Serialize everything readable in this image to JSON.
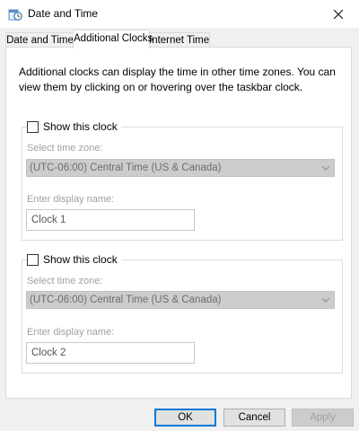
{
  "window": {
    "title": "Date and Time"
  },
  "tabs": [
    {
      "label": "Date and Time",
      "active": false
    },
    {
      "label": "Additional Clocks",
      "active": true
    },
    {
      "label": "Internet Time",
      "active": false
    }
  ],
  "panel": {
    "description": "Additional clocks can display the time in other time zones. You can view them by clicking on or hovering over the taskbar clock."
  },
  "clocks": [
    {
      "checkbox_label": "Show this clock",
      "checked": false,
      "timezone_label": "Select time zone:",
      "timezone_value": "(UTC-06:00) Central Time (US & Canada)",
      "display_name_label": "Enter display name:",
      "display_name_value": "Clock 1"
    },
    {
      "checkbox_label": "Show this clock",
      "checked": false,
      "timezone_label": "Select time zone:",
      "timezone_value": "(UTC-06:00) Central Time (US & Canada)",
      "display_name_label": "Enter display name:",
      "display_name_value": "Clock 2"
    }
  ],
  "buttons": {
    "ok": "OK",
    "cancel": "Cancel",
    "apply": "Apply"
  },
  "colors": {
    "ok_border": "#0078d7",
    "disabled_text": "#a0a0a0"
  },
  "icons": {
    "title": "clock-app-icon",
    "close": "close-icon",
    "dropdown": "chevron-down-icon"
  }
}
